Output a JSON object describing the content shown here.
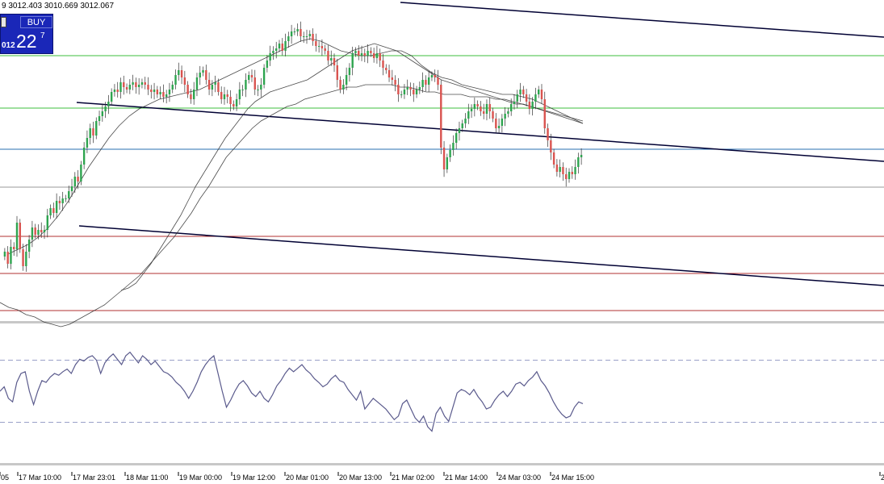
{
  "ohlc_text": "9 3012.403 3010.669 3012.067",
  "trade_panel": {
    "button_label": "BUY",
    "left_price": "012",
    "big_price": "22",
    "superscript": "7"
  },
  "colors": {
    "bull_candle": "#2ea44f",
    "bear_candle": "#d9534f",
    "wick": "#333333",
    "ma": "#2b2b2b",
    "green_level": "#3cbf3c",
    "blue_level": "#2a6fb0",
    "red_level": "#b03030",
    "grey_level": "#9a9a9a",
    "trendline": "#000033",
    "indicator": "#5a5a8c",
    "indicator_level": "#9aa0c8"
  },
  "chart_data": {
    "type": "line",
    "x_tick_labels": [
      "05",
      "17 Mar 10:00",
      "17 Mar 23:01",
      "18 Mar 11:00",
      "19 Mar 00:00",
      "19 Mar 12:00",
      "20 Mar 01:00",
      "20 Mar 13:00",
      "21 Mar 02:00",
      "21 Mar 14:00",
      "24 Mar 03:00",
      "24 Mar 15:00",
      "2"
    ],
    "price_series": [
      {
        "name": "",
        "values": [
          0.21,
          0.16,
          0.23,
          0.22,
          0.33,
          0.22,
          0.15,
          0.21,
          0.26,
          0.31,
          0.28,
          0.3,
          0.29,
          0.3,
          0.36,
          0.39,
          0.37,
          0.42,
          0.41,
          0.43,
          0.43,
          0.46,
          0.48,
          0.52,
          0.5,
          0.57,
          0.64,
          0.68,
          0.72,
          0.69,
          0.75,
          0.77,
          0.79,
          0.81,
          0.83,
          0.87,
          0.88,
          0.87,
          0.91,
          0.89,
          0.88,
          0.9,
          0.91,
          0.89,
          0.9,
          0.91,
          0.9,
          0.88,
          0.87,
          0.88,
          0.86,
          0.87,
          0.85,
          0.86,
          0.88,
          0.9,
          0.94,
          0.96,
          0.93,
          0.9,
          0.86,
          0.84,
          0.88,
          0.93,
          0.95,
          0.96,
          0.92,
          0.88,
          0.9,
          0.91,
          0.87,
          0.84,
          0.86,
          0.85,
          0.82,
          0.81,
          0.84,
          0.88,
          0.88,
          0.92,
          0.94,
          0.93,
          0.88,
          0.88,
          0.9,
          0.97,
          1.0,
          1.03,
          1.04,
          1.05,
          1.07,
          1.04,
          1.08,
          1.1,
          1.12,
          1.12,
          1.13,
          1.1,
          1.1,
          1.1,
          1.11,
          1.08,
          1.06,
          1.06,
          1.05,
          1.04,
          1.0,
          1.01,
          0.98,
          0.92,
          0.88,
          0.9,
          0.94,
          0.97,
          1.03,
          1.04,
          1.02,
          1.03,
          1.02,
          1.04,
          1.03,
          1.01,
          1.03,
          1.0,
          0.97,
          0.96,
          0.93,
          0.92,
          0.9,
          0.86,
          0.86,
          0.88,
          0.89,
          0.88,
          0.86,
          0.88,
          0.89,
          0.92,
          0.9,
          0.93,
          0.94,
          0.93,
          0.9,
          0.64,
          0.55,
          0.6,
          0.63,
          0.66,
          0.7,
          0.72,
          0.74,
          0.76,
          0.79,
          0.8,
          0.82,
          0.81,
          0.79,
          0.78,
          0.82,
          0.79,
          0.76,
          0.72,
          0.73,
          0.76,
          0.78,
          0.79,
          0.82,
          0.83,
          0.86,
          0.88,
          0.86,
          0.83,
          0.8,
          0.83,
          0.86,
          0.88,
          0.84,
          0.72,
          0.67,
          0.62,
          0.57,
          0.54,
          0.56,
          0.53,
          0.51,
          0.54,
          0.53,
          0.56,
          0.6,
          0.61
        ]
      }
    ],
    "moving_averages": [
      {
        "name": "",
        "values": [
          0.0,
          -0.02,
          -0.03,
          -0.05,
          -0.06,
          -0.08,
          -0.09,
          -0.1,
          -0.09,
          -0.07,
          -0.05,
          -0.03,
          -0.01,
          0.02,
          0.05,
          0.08,
          0.11,
          0.15,
          0.19,
          0.23,
          0.27,
          0.32,
          0.37,
          0.43,
          0.48,
          0.54,
          0.6,
          0.64,
          0.68,
          0.72,
          0.75,
          0.77,
          0.79,
          0.81,
          0.82,
          0.84,
          0.85,
          0.86,
          0.87,
          0.88,
          0.89,
          0.89,
          0.9,
          0.9,
          0.9,
          0.9,
          0.89,
          0.89,
          0.88,
          0.87,
          0.87,
          0.86,
          0.86,
          0.86,
          0.85,
          0.85,
          0.85,
          0.84,
          0.84,
          0.83,
          0.82,
          0.81,
          0.8,
          0.79,
          0.78,
          0.77,
          0.76,
          0.75
        ]
      },
      {
        "name": "",
        "values": [
          0.05,
          0.06,
          0.08,
          0.12,
          0.16,
          0.21,
          0.26,
          0.31,
          0.36,
          0.42,
          0.48,
          0.53,
          0.58,
          0.63,
          0.68,
          0.72,
          0.76,
          0.8,
          0.83,
          0.85,
          0.87,
          0.88,
          0.89,
          0.9,
          0.91,
          0.92,
          0.94,
          0.96,
          0.98,
          1.0,
          1.02,
          1.04,
          1.05,
          1.06,
          1.07,
          1.06,
          1.05,
          1.04,
          1.02,
          1.0,
          0.98,
          0.96,
          0.94,
          0.92,
          0.91,
          0.9,
          0.89,
          0.88,
          0.87,
          0.86,
          0.85,
          0.84,
          0.83,
          0.82,
          0.82,
          0.81,
          0.8,
          0.79,
          0.78,
          0.77,
          0.76,
          0.75,
          0.74
        ]
      },
      {
        "name": "",
        "values": [
          0.2,
          0.22,
          0.24,
          0.27,
          0.31,
          0.36,
          0.42,
          0.49,
          0.56,
          0.62,
          0.68,
          0.73,
          0.77,
          0.8,
          0.82,
          0.84,
          0.85,
          0.86,
          0.87,
          0.88,
          0.9,
          0.92,
          0.94,
          0.96,
          0.98,
          1.0,
          1.02,
          1.04,
          1.06,
          1.08,
          1.09,
          1.08,
          1.06,
          1.04,
          1.03,
          1.02,
          1.02,
          1.03,
          1.04,
          1.04,
          1.02,
          0.98,
          0.95,
          0.93,
          0.92,
          0.9,
          0.89,
          0.88,
          0.87,
          0.86,
          0.86,
          0.85,
          0.84,
          0.82,
          0.8,
          0.78,
          0.76,
          0.74
        ]
      }
    ],
    "indicator_series": [
      {
        "name": "",
        "values": [
          0.5,
          0.55,
          0.42,
          0.38,
          0.6,
          0.7,
          0.72,
          0.5,
          0.35,
          0.5,
          0.62,
          0.6,
          0.66,
          0.7,
          0.68,
          0.72,
          0.75,
          0.7,
          0.8,
          0.86,
          0.84,
          0.88,
          0.9,
          0.85,
          0.7,
          0.82,
          0.88,
          0.92,
          0.86,
          0.8,
          0.9,
          0.94,
          0.88,
          0.82,
          0.9,
          0.86,
          0.8,
          0.84,
          0.78,
          0.72,
          0.7,
          0.66,
          0.6,
          0.56,
          0.5,
          0.42,
          0.5,
          0.6,
          0.72,
          0.8,
          0.86,
          0.9,
          0.7,
          0.5,
          0.32,
          0.4,
          0.5,
          0.58,
          0.62,
          0.56,
          0.48,
          0.44,
          0.5,
          0.42,
          0.38,
          0.46,
          0.56,
          0.62,
          0.7,
          0.76,
          0.72,
          0.76,
          0.8,
          0.74,
          0.7,
          0.64,
          0.6,
          0.55,
          0.58,
          0.64,
          0.68,
          0.62,
          0.6,
          0.52,
          0.46,
          0.4,
          0.5,
          0.3,
          0.36,
          0.42,
          0.38,
          0.34,
          0.3,
          0.24,
          0.18,
          0.22,
          0.36,
          0.4,
          0.3,
          0.2,
          0.15,
          0.22,
          0.1,
          0.05,
          0.25,
          0.32,
          0.22,
          0.16,
          0.32,
          0.48,
          0.52,
          0.5,
          0.46,
          0.52,
          0.44,
          0.38,
          0.3,
          0.32,
          0.4,
          0.46,
          0.5,
          0.44,
          0.5,
          0.58,
          0.6,
          0.56,
          0.62,
          0.66,
          0.72,
          0.62,
          0.56,
          0.48,
          0.38,
          0.3,
          0.24,
          0.2,
          0.22,
          0.32,
          0.38,
          0.36
        ]
      }
    ],
    "indicator_levels": [
      0.85,
      0.15
    ],
    "title": "",
    "xlabel": "",
    "ylabel": "",
    "grid": false
  }
}
